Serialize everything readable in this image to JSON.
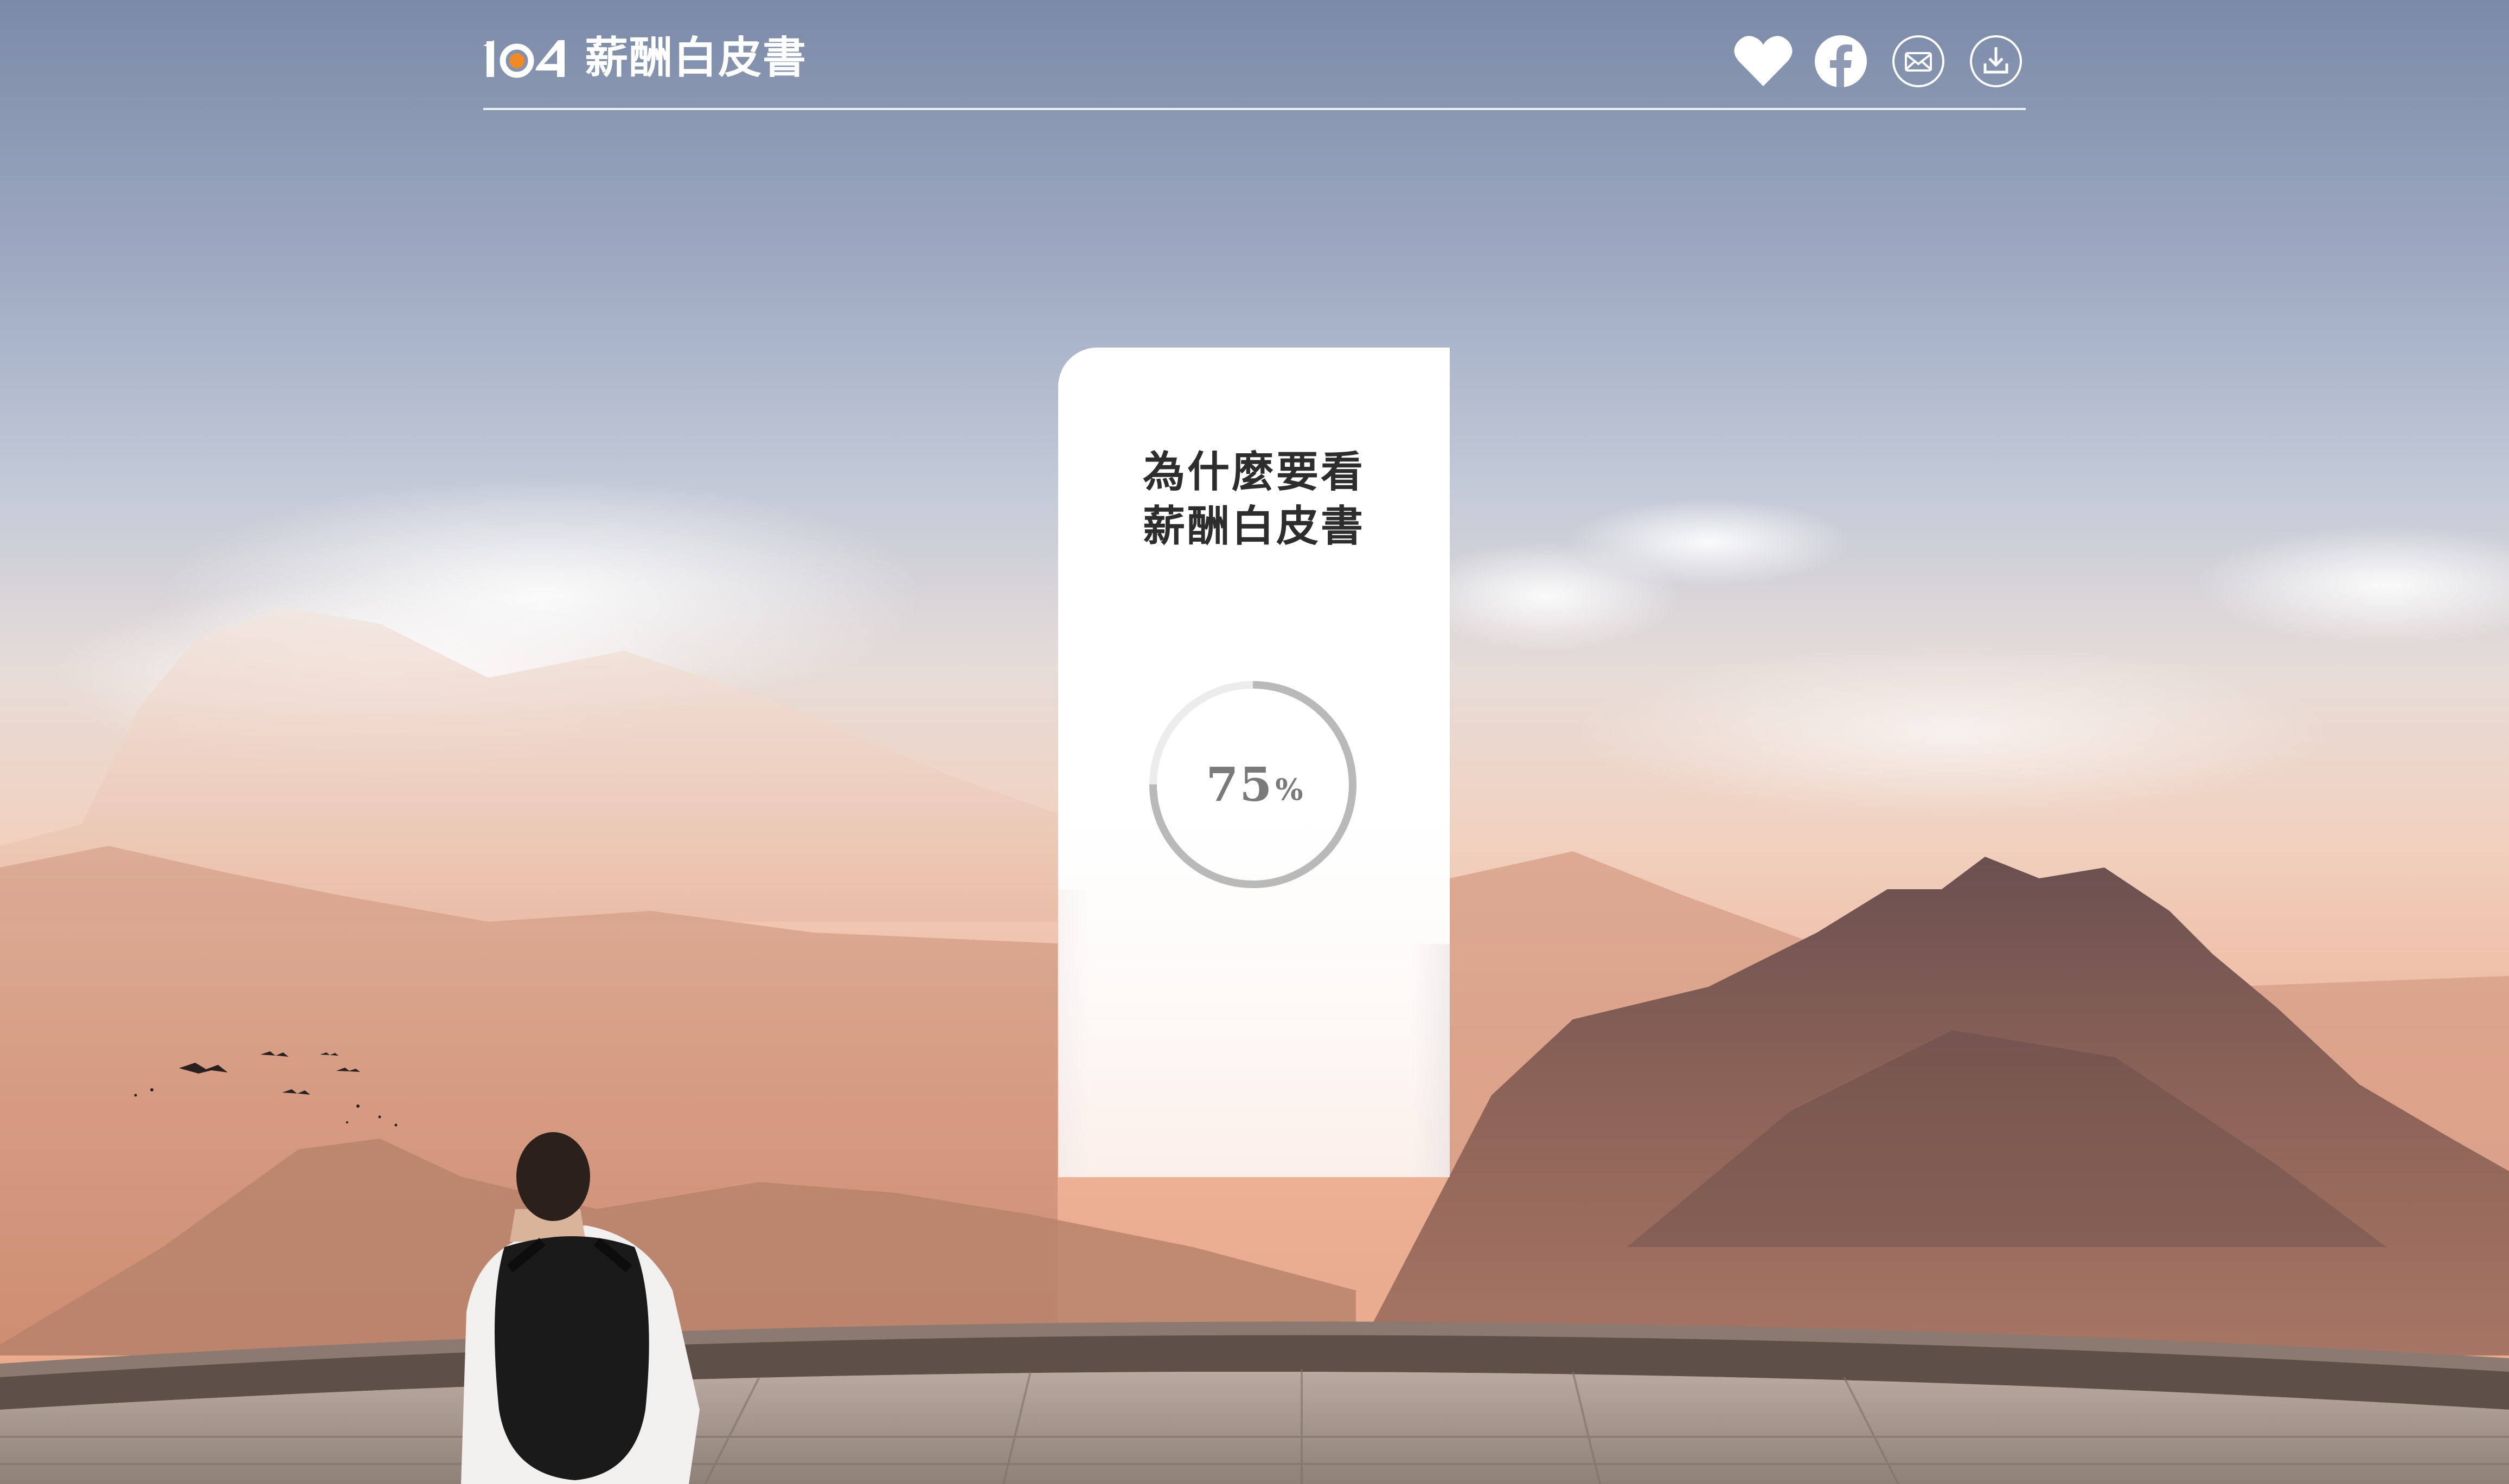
{
  "header": {
    "brand_number": "104",
    "brand_title": "薪酬白皮書",
    "accent_color": "#f08a24",
    "icons": [
      "heart-icon",
      "facebook-icon",
      "mail-icon",
      "download-icon"
    ]
  },
  "intro_card": {
    "title_line1": "為什麼要看",
    "title_line2": "薪酬白皮書",
    "progress_value": "75",
    "progress_unit": "%",
    "progress_fraction": 0.75
  }
}
